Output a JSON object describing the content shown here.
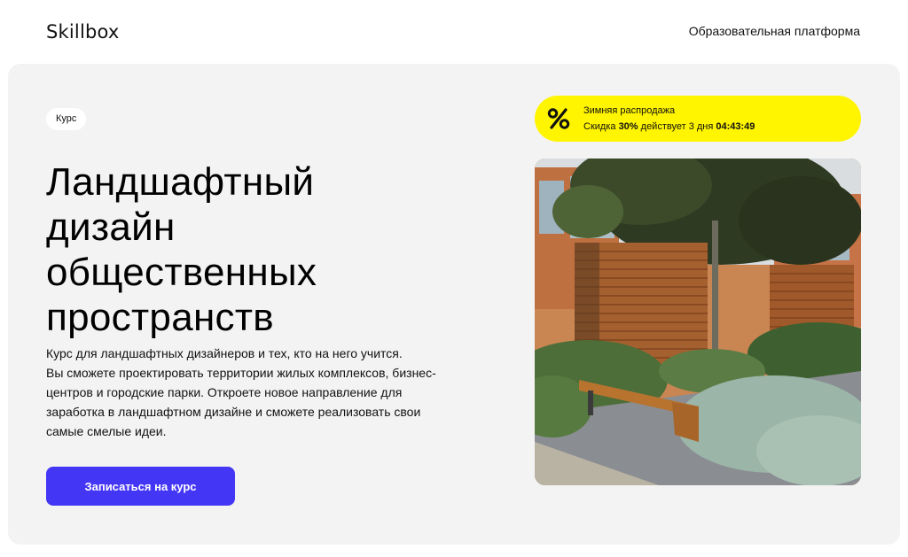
{
  "header": {
    "logo": "Skillbox",
    "platform_link": "Образовательная платформа"
  },
  "hero": {
    "badge": "Курс",
    "title_lines": [
      "Ландшафтный",
      "дизайн",
      "общественных",
      "пространств"
    ],
    "description_lines": [
      "Курс для ландшафтных дизайнеров и тех, кто на него учится.",
      "Вы сможете проектировать территории жилых комплексов, бизнес-",
      "центров и городские парки. Откроете новое направление для",
      "заработка в ландшафтном дизайне и сможете реализовать свои",
      "самые смелые идеи."
    ],
    "cta_label": "Записаться на курс"
  },
  "sale": {
    "icon": "percent-icon",
    "title": "Зимняя распродажа",
    "text_prefix": "Скидка ",
    "discount": "30%",
    "text_middle": " действует 3 дня ",
    "timer": "04:43:49"
  },
  "photo": {
    "icon": "landscape-photo"
  },
  "colors": {
    "accent": "#4436f5",
    "sale_bg": "#fff500",
    "hero_bg": "#f3f3f3"
  }
}
